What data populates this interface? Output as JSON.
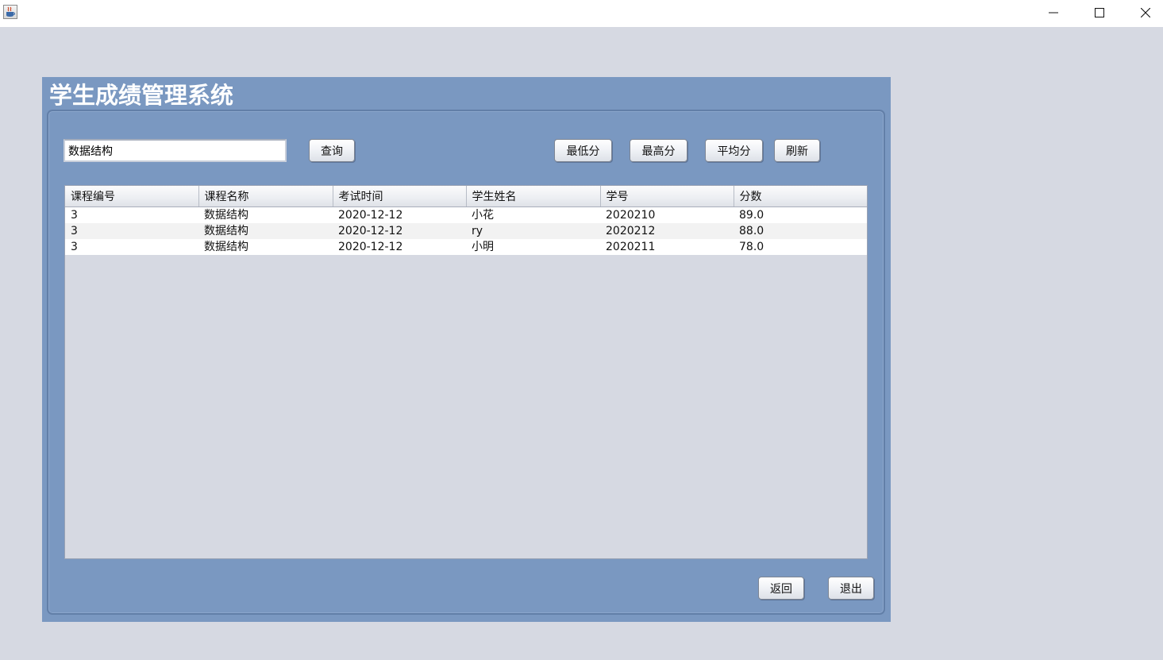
{
  "window": {
    "app_icon": "java-cup-icon",
    "controls": [
      "minimize-icon",
      "maximize-icon",
      "close-icon"
    ]
  },
  "header": {
    "title": "学生成绩管理系统"
  },
  "search": {
    "value": "数据结构",
    "query_label": "查询"
  },
  "toolbar": {
    "min_label": "最低分",
    "max_label": "最高分",
    "avg_label": "平均分",
    "refresh_label": "刷新"
  },
  "table": {
    "columns": [
      "课程编号",
      "课程名称",
      "考试时间",
      "学生姓名",
      "学号",
      "分数"
    ],
    "rows": [
      [
        "3",
        "数据结构",
        "2020-12-12",
        "小花",
        "2020210",
        "89.0"
      ],
      [
        "3",
        "数据结构",
        "2020-12-12",
        "ry",
        "2020212",
        "88.0"
      ],
      [
        "3",
        "数据结构",
        "2020-12-12",
        "小明",
        "2020211",
        "78.0"
      ]
    ]
  },
  "footer": {
    "back_label": "返回",
    "exit_label": "退出"
  },
  "colors": {
    "frame": "#7a98c1",
    "background": "#d6d9e2"
  }
}
